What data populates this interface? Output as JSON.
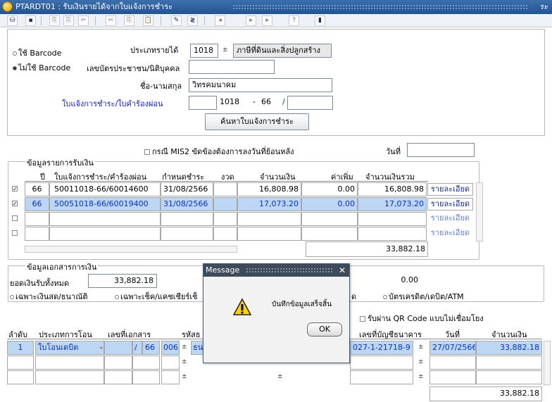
{
  "window": {
    "title": "PTARDT01 : รับเงินรายได้จากใบแจ้งการชำระ",
    "controls": "ระ"
  },
  "toolbar": {
    "icons": [
      "query-icon",
      "save-icon",
      "first-icon",
      "prev-icon",
      "next-icon",
      "cut-icon",
      "copy-icon",
      "paste-icon",
      "edit-icon",
      "insert-icon",
      "delete-icon",
      "prev-record-icon",
      "next-record-icon",
      "last-record-icon",
      "help-icon",
      "exit-icon"
    ]
  },
  "header": {
    "barcode_use": "ใช้ Barcode",
    "barcode_nouse": "ไม่ใช้ Barcode",
    "income_type_label": "ประเภทรายได้",
    "income_type_code": "1018",
    "income_type_name": "ภาษีที่ดินและสิ่งปลูกสร้าง",
    "id_card_label": "เลขบัตรประชาชน/นิติบุคคล",
    "id_card_value": "",
    "name_label": "ชื่อ-นามสกุล",
    "name_value": "วิทรคมนาคม",
    "invoice_label": "ใบแจ้งการชำระ/ใบคำร้องผ่อน",
    "invoice_prefix": "",
    "invoice_code": "1018",
    "invoice_sep": "-",
    "invoice_year": "66",
    "invoice_slash": "/",
    "invoice_no": "",
    "search_button": "ค้นหาใบแจ้งการชำระ"
  },
  "mis2": {
    "label": "กรณี MIS2 ขัดข้องต้องการลงวันที่ย้อนหลัง",
    "date_label": "วันที่",
    "date_value": ""
  },
  "receipt_group": {
    "title": "ข้อมูลรายการรับเงิน",
    "columns": [
      "ปี",
      "ใบแจ้งการชำระ/คำร้องผ่อน",
      "กำหนดชำระ",
      "งวด",
      "จำนวนเงิน",
      "ค่าเพิ่ม",
      "จำนวนเงินรวม"
    ],
    "rows": [
      {
        "checked": "✓",
        "year": "66",
        "invoice": "50011018-66/60014600",
        "due": "31/08/2566",
        "period": "",
        "amount": "16,808.98",
        "extra": "0.00",
        "total": "16,808.98",
        "detail": "รายละเอียด"
      },
      {
        "checked": "✓",
        "year": "66",
        "invoice": "50051018-66/60019400",
        "due": "31/08/2566",
        "period": "",
        "amount": "17,073.20",
        "extra": "0.00",
        "total": "17,073.20",
        "detail": "รายละเอียด"
      },
      {
        "checked": "",
        "year": "",
        "invoice": "",
        "due": "",
        "period": "",
        "amount": "",
        "extra": "",
        "total": "",
        "detail": "รายละเอียด"
      },
      {
        "checked": "",
        "year": "",
        "invoice": "",
        "due": "",
        "period": "",
        "amount": "",
        "extra": "",
        "total": "",
        "detail": "รายละเอียด"
      }
    ],
    "sum_total": "33,882.18"
  },
  "payment_group": {
    "title": "ข้อมูลเอกสารการเงิน",
    "total_label": "ยอดเงินรับทั้งหมด",
    "total_value": "33,882.18",
    "other_value": "0.00",
    "opt_cash": "เฉพาะเงินสด/ธนาณัติ",
    "opt_cheque": "เฉพาะเช็ค/แคชเชียร์เช็",
    "opt_mid": "ด",
    "opt_card": "บัตรเครดิต/เดบิต/ATM"
  },
  "transfer": {
    "qr_label": "รับผ่าน QR Code แบบไม่เชื่อมโยง",
    "columns": [
      "ลำดับ",
      "ประเภทการโอน",
      "เลขที่เอกสาร",
      "รหัสธ",
      "เลขที่บัญชีธนาคาร",
      "วันที่",
      "จำนวนเงิน"
    ],
    "row": {
      "seq": "1",
      "type": "ใบโอนเดบิต",
      "doc_slash": "/",
      "doc_year": "66",
      "bank_code": "006",
      "bank_name": "ธน",
      "account": "027-1-21718-9",
      "date": "27/07/2566",
      "amount": "33,882.18"
    },
    "sum_total": "33,882.18"
  },
  "dialog": {
    "title": "Message",
    "close": "✕",
    "message": "บันทึกข้อมูลเสร็จสิ้น",
    "ok": "OK"
  }
}
